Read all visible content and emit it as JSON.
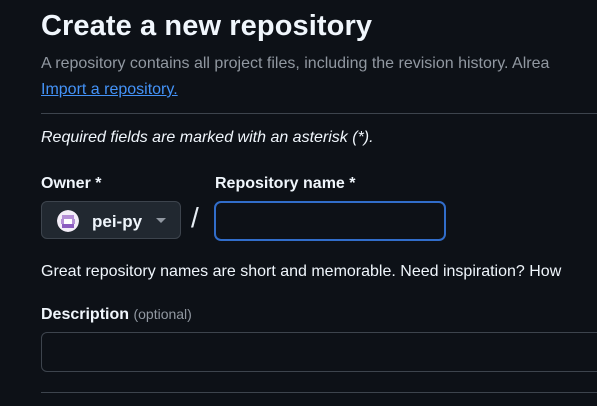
{
  "header": {
    "title": "Create a new repository",
    "subtitle": "A repository contains all project files, including the revision history. Alrea",
    "import_link": "Import a repository."
  },
  "form": {
    "required_note": "Required fields are marked with an asterisk (*).",
    "owner": {
      "label": "Owner *",
      "selected": "pei-py",
      "avatar_icon": "owner-avatar"
    },
    "separator": "/",
    "repo_name": {
      "label": "Repository name *",
      "value": "",
      "focused": true
    },
    "name_hint": "Great repository names are short and memorable. Need inspiration? How",
    "description": {
      "label": "Description",
      "optional": "(optional)",
      "value": ""
    }
  },
  "colors": {
    "background": "#0d1117",
    "link": "#4493f8",
    "focus_border": "#316dca",
    "muted_text": "#9198a1"
  }
}
